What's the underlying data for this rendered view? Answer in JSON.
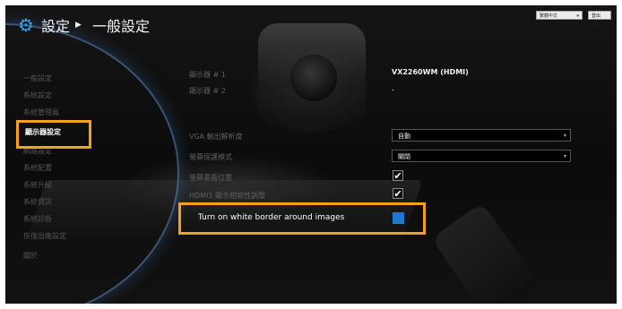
{
  "header": {
    "title": "設定",
    "subtitle": "一般設定",
    "gear_icon": "gear-icon",
    "arrow_icon": "triangle-right-icon"
  },
  "top": {
    "language": "繁體中文",
    "logout": "登出 [X]"
  },
  "sidebar": {
    "items": [
      {
        "label": "一般設定"
      },
      {
        "label": "系統設定"
      },
      {
        "label": "系統管理員"
      },
      {
        "label": "顯示器設定"
      },
      {
        "label": "網路設定"
      },
      {
        "label": "系統配置"
      },
      {
        "label": "系統升級"
      },
      {
        "label": "系統資訊"
      },
      {
        "label": "系統診斷"
      },
      {
        "label": "恢復出廠設定"
      },
      {
        "label": "關於"
      }
    ]
  },
  "main": {
    "monitor1_label": "顯示器 # 1",
    "monitor1_value": "VX2260WM (HDMI)",
    "monitor2_label": "顯示器 # 2",
    "monitor2_value": "-",
    "vga_label": "VGA 輸出解析度",
    "vga_value": "自動",
    "screensaver_label": "螢幕保護模式",
    "screensaver_value": "關閉",
    "overscan_label": "螢幕畫面位置",
    "hdmi_label": "HDMI1 顯示相容性調整",
    "white_border_label": "Turn on white border around images"
  },
  "colors": {
    "accent": "#f2a21a",
    "checkbox_blue": "#1f78d1",
    "icon_blue": "#3aa0e8"
  }
}
